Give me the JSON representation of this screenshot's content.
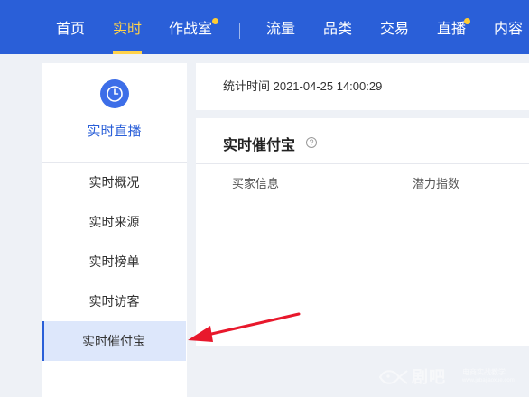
{
  "topnav": {
    "items": [
      {
        "label": "首页"
      },
      {
        "label": "实时"
      },
      {
        "label": "作战室"
      },
      {
        "label": "流量"
      },
      {
        "label": "品类"
      },
      {
        "label": "交易"
      },
      {
        "label": "直播"
      },
      {
        "label": "内容"
      }
    ],
    "active_label": "实时"
  },
  "sidebar": {
    "title": "实时直播",
    "icon": "clock-icon",
    "items": [
      {
        "label": "实时概况"
      },
      {
        "label": "实时来源"
      },
      {
        "label": "实时榜单"
      },
      {
        "label": "实时访客"
      },
      {
        "label": "实时催付宝"
      }
    ],
    "active_label": "实时催付宝"
  },
  "stats": {
    "time_text": "统计时间 2021-04-25 14:00:29"
  },
  "panel": {
    "title": "实时催付宝",
    "help_glyph": "?",
    "columns": [
      "买家信息",
      "潜力指数"
    ]
  },
  "watermark": {
    "brand": "剧吧",
    "line1": "电商实战教学",
    "line2": "www.jubajiaoxue.com"
  },
  "colors": {
    "nav_bg": "#2a5fd8",
    "nav_active": "#ffd24a",
    "sidebar_active_bg": "#dde7fb",
    "annotation_arrow": "#e8182c"
  }
}
